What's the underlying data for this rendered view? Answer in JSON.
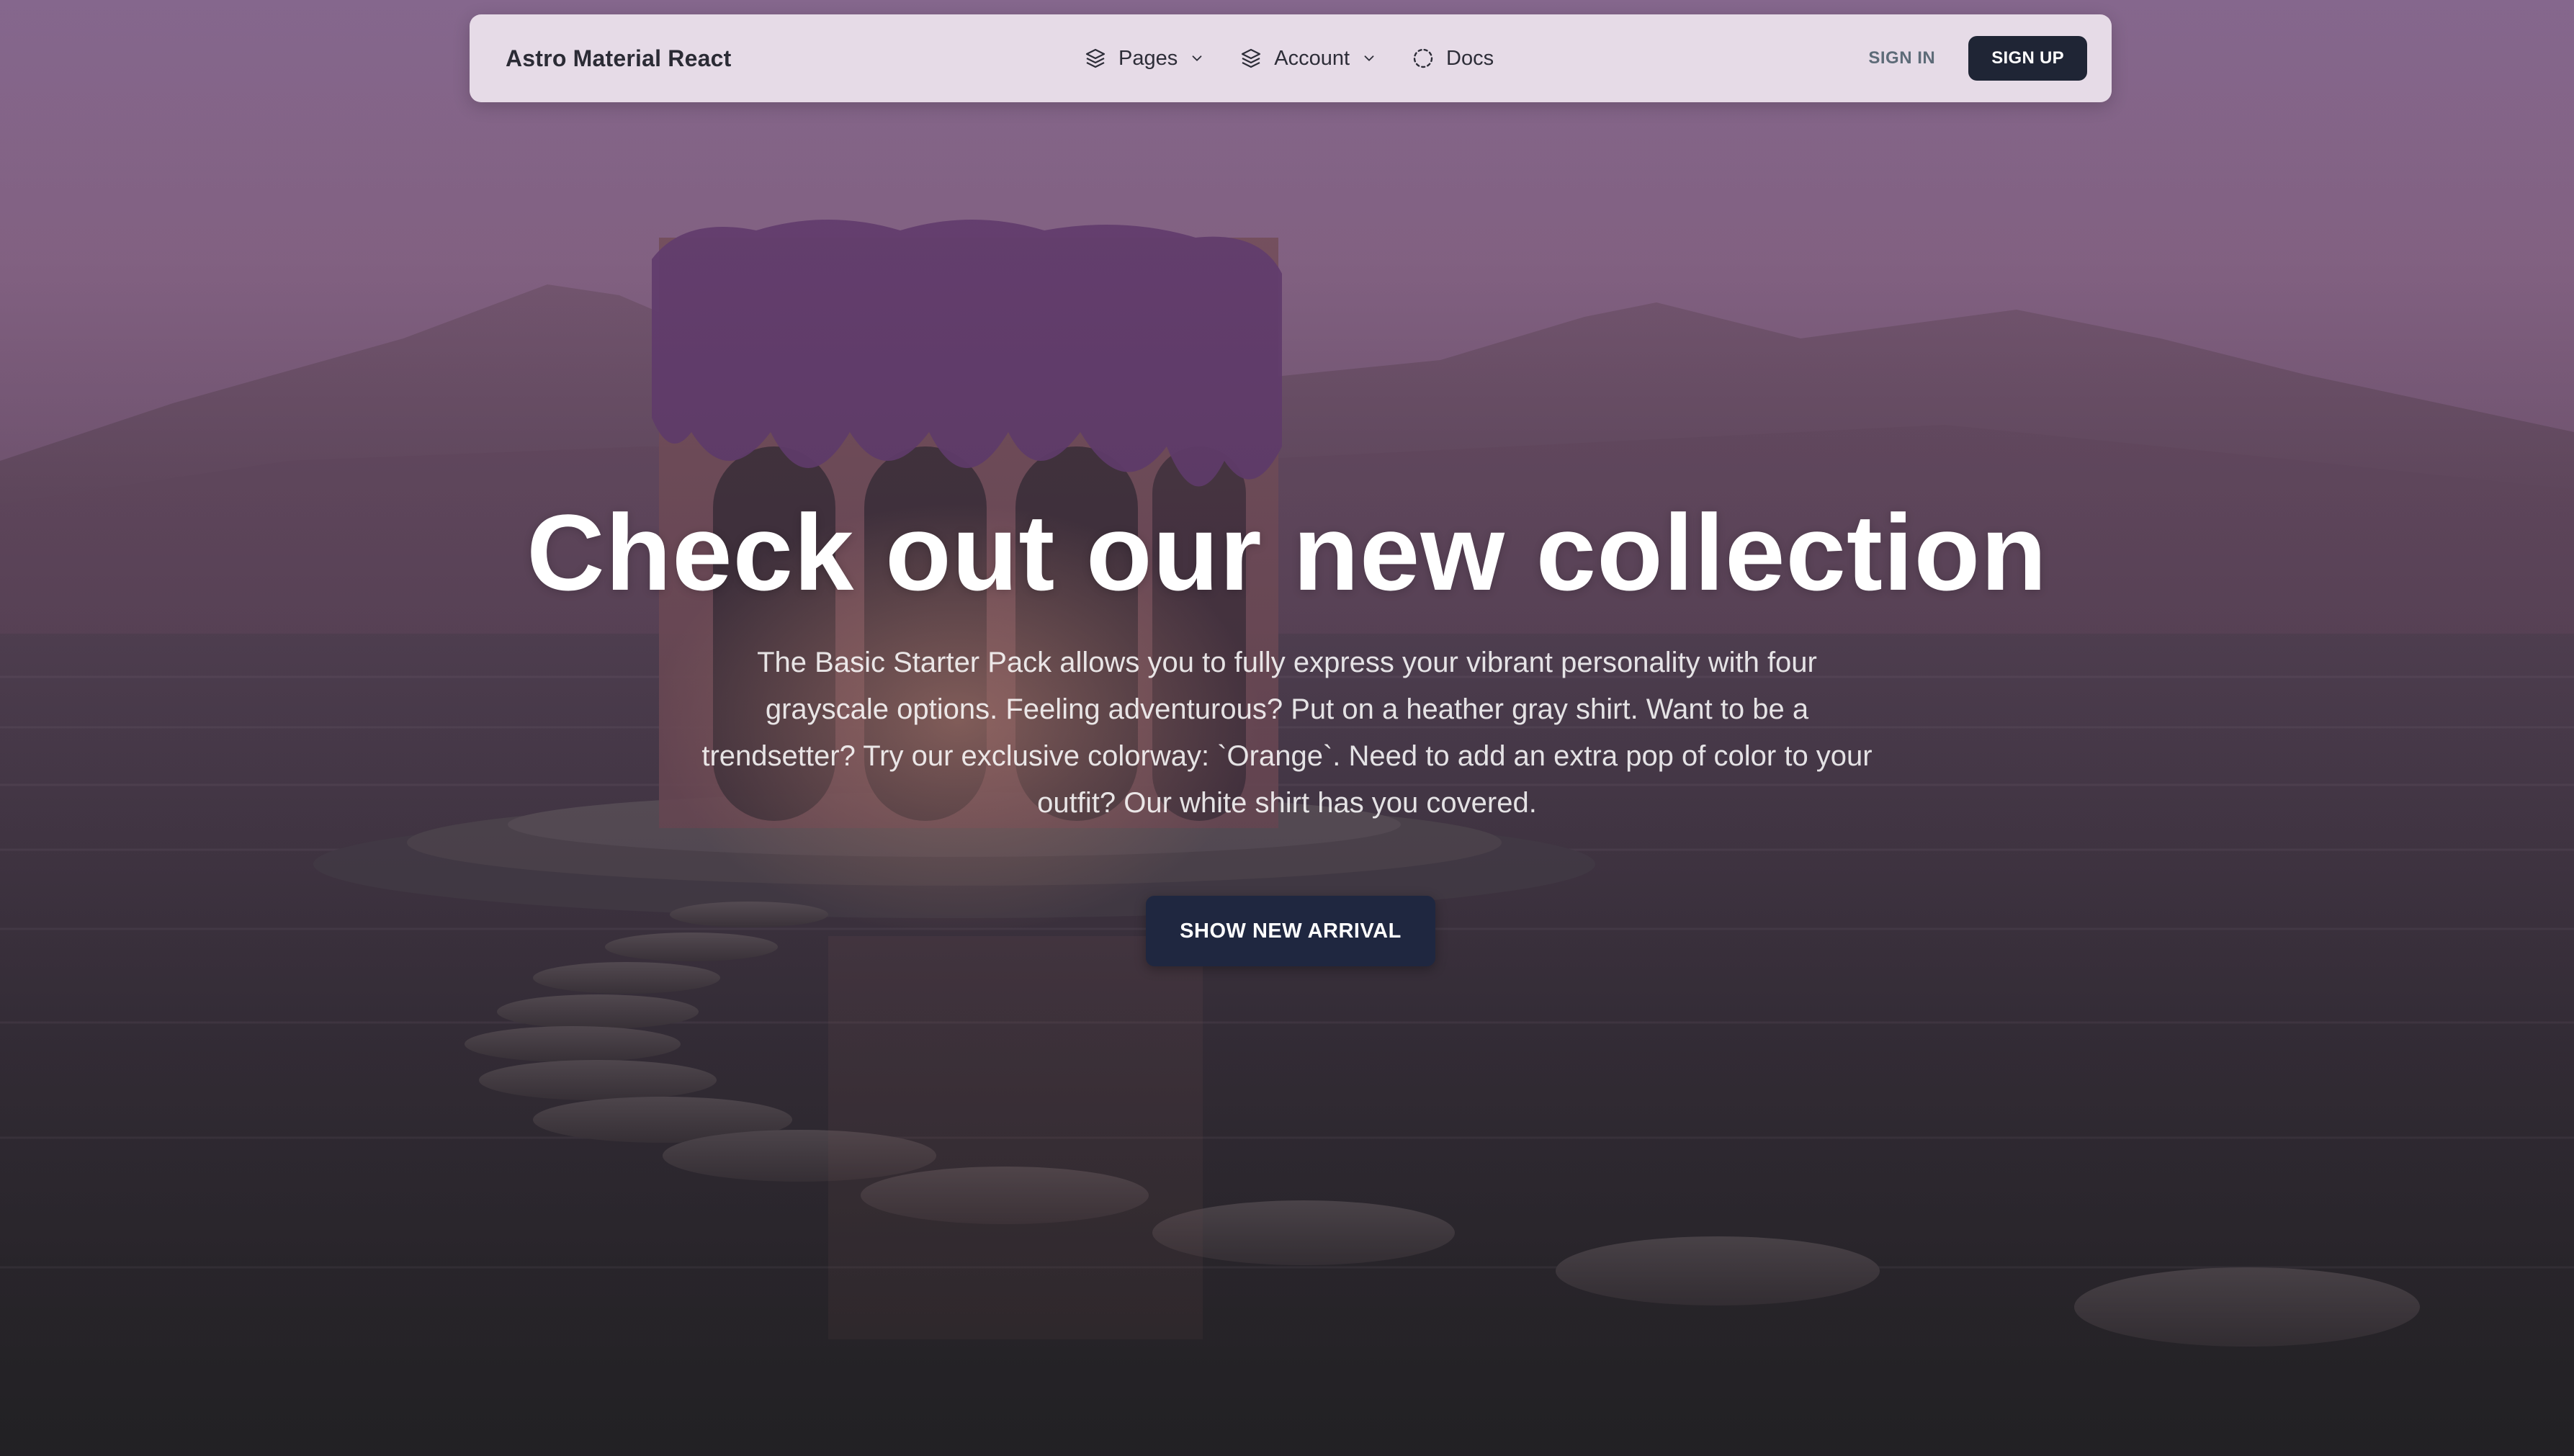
{
  "navbar": {
    "brand": "Astro Material React",
    "items": [
      {
        "label": "Pages",
        "icon": "stack-icon",
        "has_dropdown": true
      },
      {
        "label": "Account",
        "icon": "stack-icon",
        "has_dropdown": true
      },
      {
        "label": "Docs",
        "icon": "dashed-circle-icon",
        "has_dropdown": false
      }
    ],
    "sign_in": "SIGN IN",
    "sign_up": "SIGN UP"
  },
  "hero": {
    "title": "Check out our new collection",
    "description": "The Basic Starter Pack allows you to fully express your vibrant personality with four grayscale options. Feeling adventurous? Put on a heather gray shirt. Want to be a trendsetter? Try our exclusive colorway: `Orange`. Need to add an extra pop of color to your outfit? Our white shirt has you covered.",
    "cta": "SHOW NEW ARRIVAL"
  },
  "colors": {
    "navbar_bg": "#EEE4EE",
    "primary_dark": "#1F2535",
    "signin_text": "#5D6B78",
    "hero_text": "#FFFFFF"
  }
}
